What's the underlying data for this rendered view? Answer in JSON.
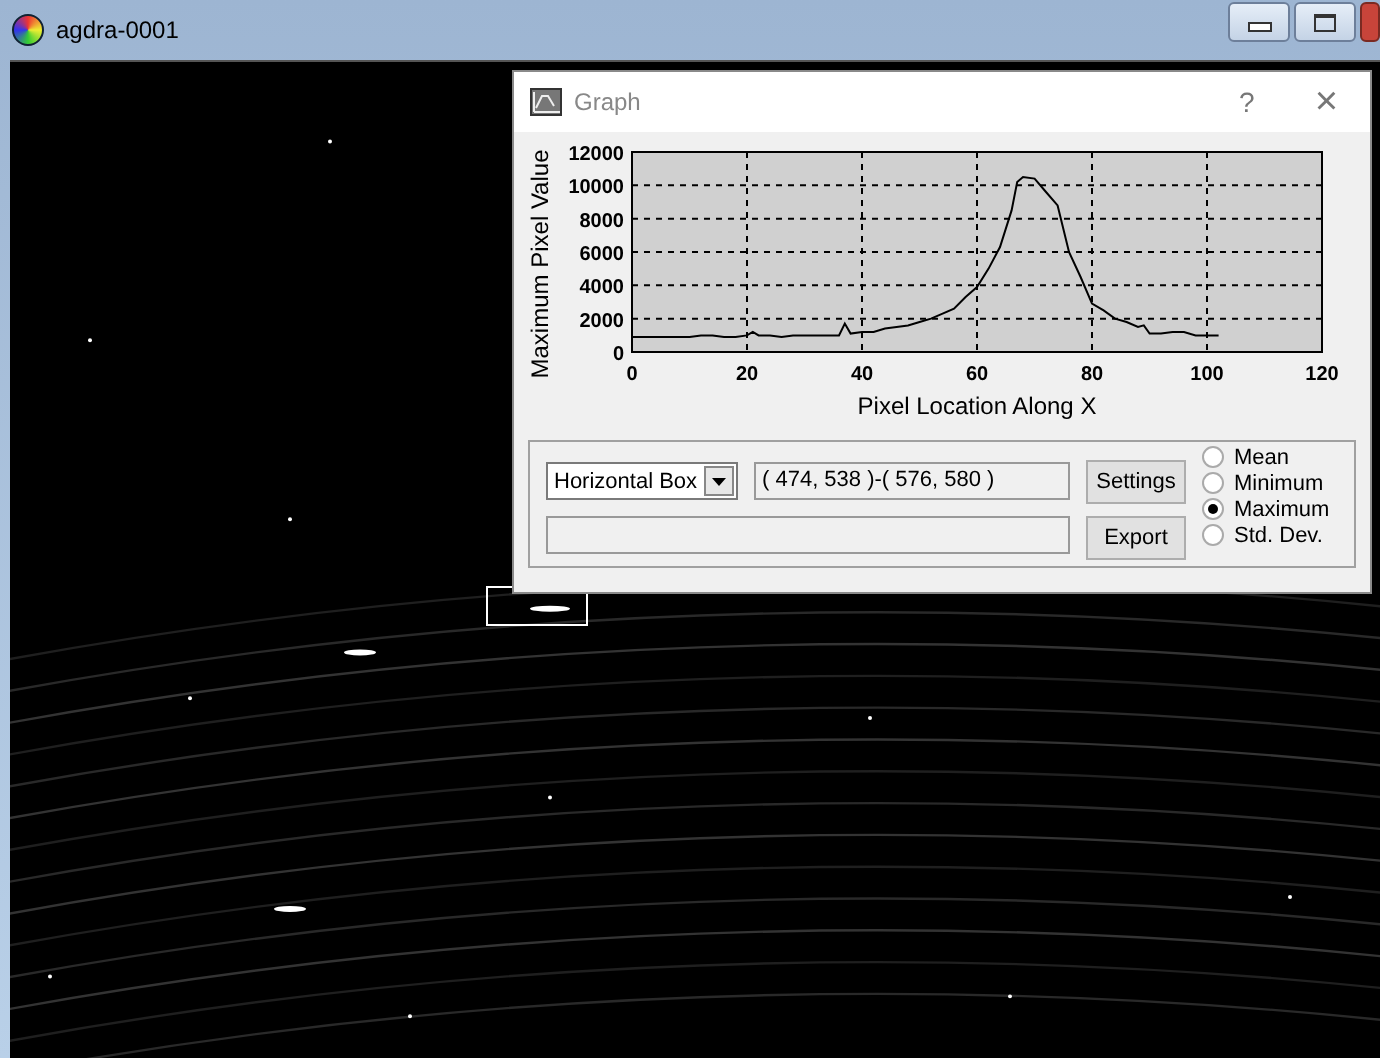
{
  "window": {
    "title": "agdra-0001"
  },
  "graph_dialog": {
    "title": "Graph",
    "help": "?",
    "close": "×",
    "chart_data": {
      "type": "line",
      "grid": true,
      "xlabel": "Pixel Location Along X",
      "ylabel": "Maximum Pixel Value",
      "xlim": [
        0,
        120
      ],
      "ylim": [
        0,
        12000
      ],
      "xticks": [
        0,
        20,
        40,
        60,
        80,
        100,
        120
      ],
      "yticks": [
        0,
        2000,
        4000,
        6000,
        8000,
        10000,
        12000
      ],
      "x": [
        0,
        2,
        4,
        6,
        8,
        10,
        12,
        14,
        16,
        18,
        20,
        21,
        22,
        24,
        26,
        28,
        30,
        32,
        34,
        36,
        37,
        38,
        40,
        42,
        44,
        46,
        48,
        50,
        52,
        54,
        56,
        58,
        60,
        62,
        64,
        66,
        67,
        68,
        70,
        72,
        74,
        76,
        78,
        80,
        82,
        84,
        86,
        88,
        89,
        90,
        92,
        94,
        96,
        98,
        100,
        102
      ],
      "series": [
        {
          "color": "#000000",
          "values": [
            900,
            900,
            900,
            900,
            900,
            900,
            1000,
            1000,
            900,
            900,
            1000,
            1200,
            1000,
            1000,
            900,
            1000,
            1000,
            1000,
            1000,
            1000,
            1700,
            1100,
            1200,
            1200,
            1400,
            1500,
            1600,
            1800,
            2000,
            2300,
            2600,
            3300,
            3900,
            5000,
            6300,
            8500,
            10200,
            10500,
            10400,
            9600,
            8800,
            6000,
            4500,
            2900,
            2500,
            2000,
            1800,
            1500,
            1600,
            1100,
            1100,
            1200,
            1200,
            1000,
            1000,
            1000
          ]
        }
      ]
    },
    "region_type": "Horizontal Box",
    "coordinates": "( 474, 538 )-( 576, 580 )",
    "buttons": [
      "Settings",
      "Export"
    ],
    "modes": [
      {
        "label": "Mean",
        "selected": false
      },
      {
        "label": "Minimum",
        "selected": false
      },
      {
        "label": "Maximum",
        "selected": true
      },
      {
        "label": "Std. Dev.",
        "selected": false
      }
    ]
  }
}
